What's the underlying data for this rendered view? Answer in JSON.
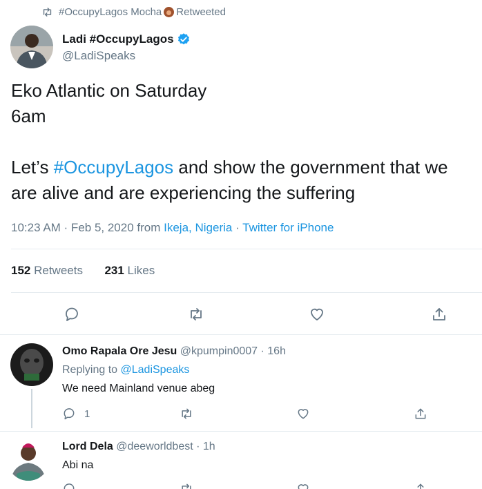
{
  "retweet_context": {
    "user": "#OccupyLagos Mocha",
    "label": "Retweeted"
  },
  "tweet": {
    "author_name": "Ladi #OccupyLagos",
    "author_handle": "@LadiSpeaks",
    "text_line1": "Eko Atlantic on Saturday",
    "text_line2": "6am",
    "text_line3_prefix": "Let’s ",
    "hashtag": "#OccupyLagos",
    "text_line3_suffix": " and show the government that we",
    "text_line4": "are alive and are experiencing the suffering",
    "time": "10:23 AM · Feb 5, 2020 from ",
    "location": "Ikeja, Nigeria",
    "separator": " · ",
    "source": "Twitter for iPhone",
    "retweets_count": "152",
    "retweets_label": " Retweets",
    "likes_count": "231",
    "likes_label": " Likes"
  },
  "replies": [
    {
      "name": "Omo Rapala Ore Jesu",
      "handle": "@kpumpin0007 · 16h",
      "replying_prefix": "Replying to ",
      "replying_to": "@LadiSpeaks",
      "text": "We need Mainland venue abeg",
      "reply_count": "1"
    },
    {
      "name": "Lord Dela",
      "handle": "@deeworldbest · 1h",
      "text": "Abi na"
    }
  ],
  "colors": {
    "link": "#1b95e0",
    "muted": "#657786",
    "text": "#14171a",
    "divider": "#e6ecf0"
  },
  "icons": [
    "retweet-icon",
    "verified-icon",
    "reply-icon",
    "like-icon",
    "share-icon"
  ]
}
